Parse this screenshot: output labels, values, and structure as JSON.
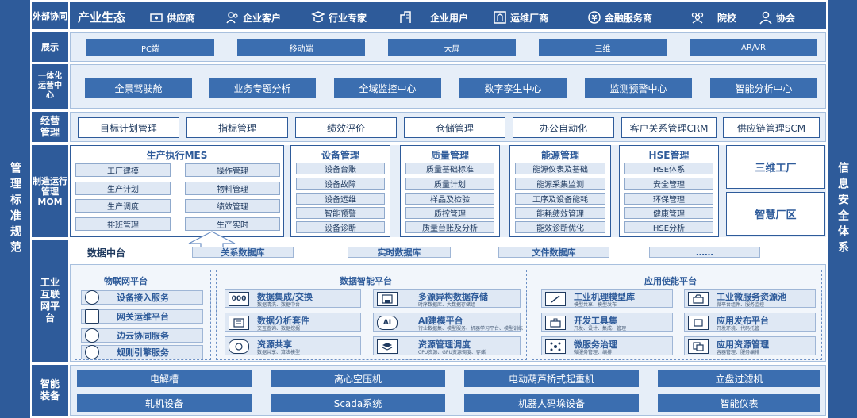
{
  "side": {
    "left": "管理标准规范",
    "right": "信息安全体系"
  },
  "rows": {
    "external": "外部协同",
    "display": "展示",
    "ops_center": "一体化运营中心",
    "management": "经营管理",
    "mom": "制造运行管理MOM",
    "iip": "工业互联网平台",
    "equipment": "智能装备"
  },
  "ecosystem": {
    "title": "产业生态",
    "items": [
      {
        "label": "供应商",
        "icon": "supplier-icon"
      },
      {
        "label": "企业客户",
        "icon": "customer-icon"
      },
      {
        "label": "行业专家",
        "icon": "expert-icon"
      },
      {
        "label": "企业用户",
        "icon": "enterprise-user-icon"
      },
      {
        "label": "运维厂商",
        "icon": "ops-vendor-icon"
      },
      {
        "label": "金融服务商",
        "icon": "finance-icon"
      },
      {
        "label": "院校",
        "icon": "school-icon"
      },
      {
        "label": "协会",
        "icon": "association-icon"
      }
    ]
  },
  "display": [
    "PC端",
    "移动端",
    "大屏",
    "三维",
    "AR/VR"
  ],
  "ops_center": [
    "全景驾驶舱",
    "业务专题分析",
    "全域监控中心",
    "数字孪生中心",
    "监测预警中心",
    "智能分析中心"
  ],
  "management": [
    "目标计划管理",
    "指标管理",
    "绩效评价",
    "仓储管理",
    "办公自动化",
    "客户关系管理CRM",
    "供应链管理SCM"
  ],
  "mom": {
    "mes": {
      "title": "生产执行MES",
      "left": [
        "工厂建模",
        "生产计划",
        "生产调度",
        "排班管理"
      ],
      "right": [
        "操作管理",
        "物料管理",
        "绩效管理",
        "生产实时"
      ]
    },
    "device": {
      "title": "设备管理",
      "items": [
        "设备台账",
        "设备故障",
        "设备运维",
        "智能预警",
        "设备诊断"
      ]
    },
    "quality": {
      "title": "质量管理",
      "items": [
        "质量基础标准",
        "质量计划",
        "样品及检验",
        "质控管理",
        "质量台账及分析"
      ]
    },
    "energy": {
      "title": "能源管理",
      "items": [
        "能源仪表及基础",
        "能源采集监测",
        "工序及设备能耗",
        "能耗绩效管理",
        "能效诊断优化"
      ]
    },
    "hse": {
      "title": "HSE管理",
      "items": [
        "HSE体系",
        "安全管理",
        "环保管理",
        "健康管理",
        "HSE分析"
      ]
    },
    "extra": [
      "三维工厂",
      "智慧厂区"
    ]
  },
  "data_platform": {
    "title": "数据中台",
    "items": [
      "关系数据库",
      "实时数据库",
      "文件数据库",
      "……"
    ]
  },
  "iot": {
    "title": "物联网平台",
    "items": [
      "设备接入服务",
      "网关运维平台",
      "边云协同服务",
      "规则引擎服务"
    ]
  },
  "data_intel": {
    "title": "数据智能平台",
    "cards": [
      {
        "title": "数据集成/交换",
        "sub": "数据清洗、数据中台"
      },
      {
        "title": "多源异构数据存储",
        "sub": "时序数据库、大数据存储组"
      },
      {
        "title": "数据分析套件",
        "sub": "交互查询、数据挖掘"
      },
      {
        "title": "AI建模平台",
        "sub": "行业数据集、模型服务、机器学习平台、模型训练"
      },
      {
        "title": "资源共享",
        "sub": "数据共享、算法模型"
      },
      {
        "title": "资源管理调度",
        "sub": "CPU资源、GPU资源调度、存储"
      }
    ]
  },
  "app_platform": {
    "title": "应用使能平台",
    "cards": [
      {
        "title": "工业机理模型库",
        "sub": "模型共享、模型发布"
      },
      {
        "title": "工业微服务资源池",
        "sub": "微平台组件、服务监控"
      },
      {
        "title": "开发工具集",
        "sub": "开发、设计、集成、管理"
      },
      {
        "title": "应用发布平台",
        "sub": "开发环境、代码托管"
      },
      {
        "title": "微服务治理",
        "sub": "微服务管理、编排"
      },
      {
        "title": "应用资源管理",
        "sub": "容器管理、服务编排"
      }
    ]
  },
  "equipment": [
    "电解槽",
    "离心空压机",
    "电动葫芦桥式起重机",
    "立盘过滤机",
    "轧机设备",
    "Scada系统",
    "机器人码垛设备",
    "智能仪表"
  ]
}
